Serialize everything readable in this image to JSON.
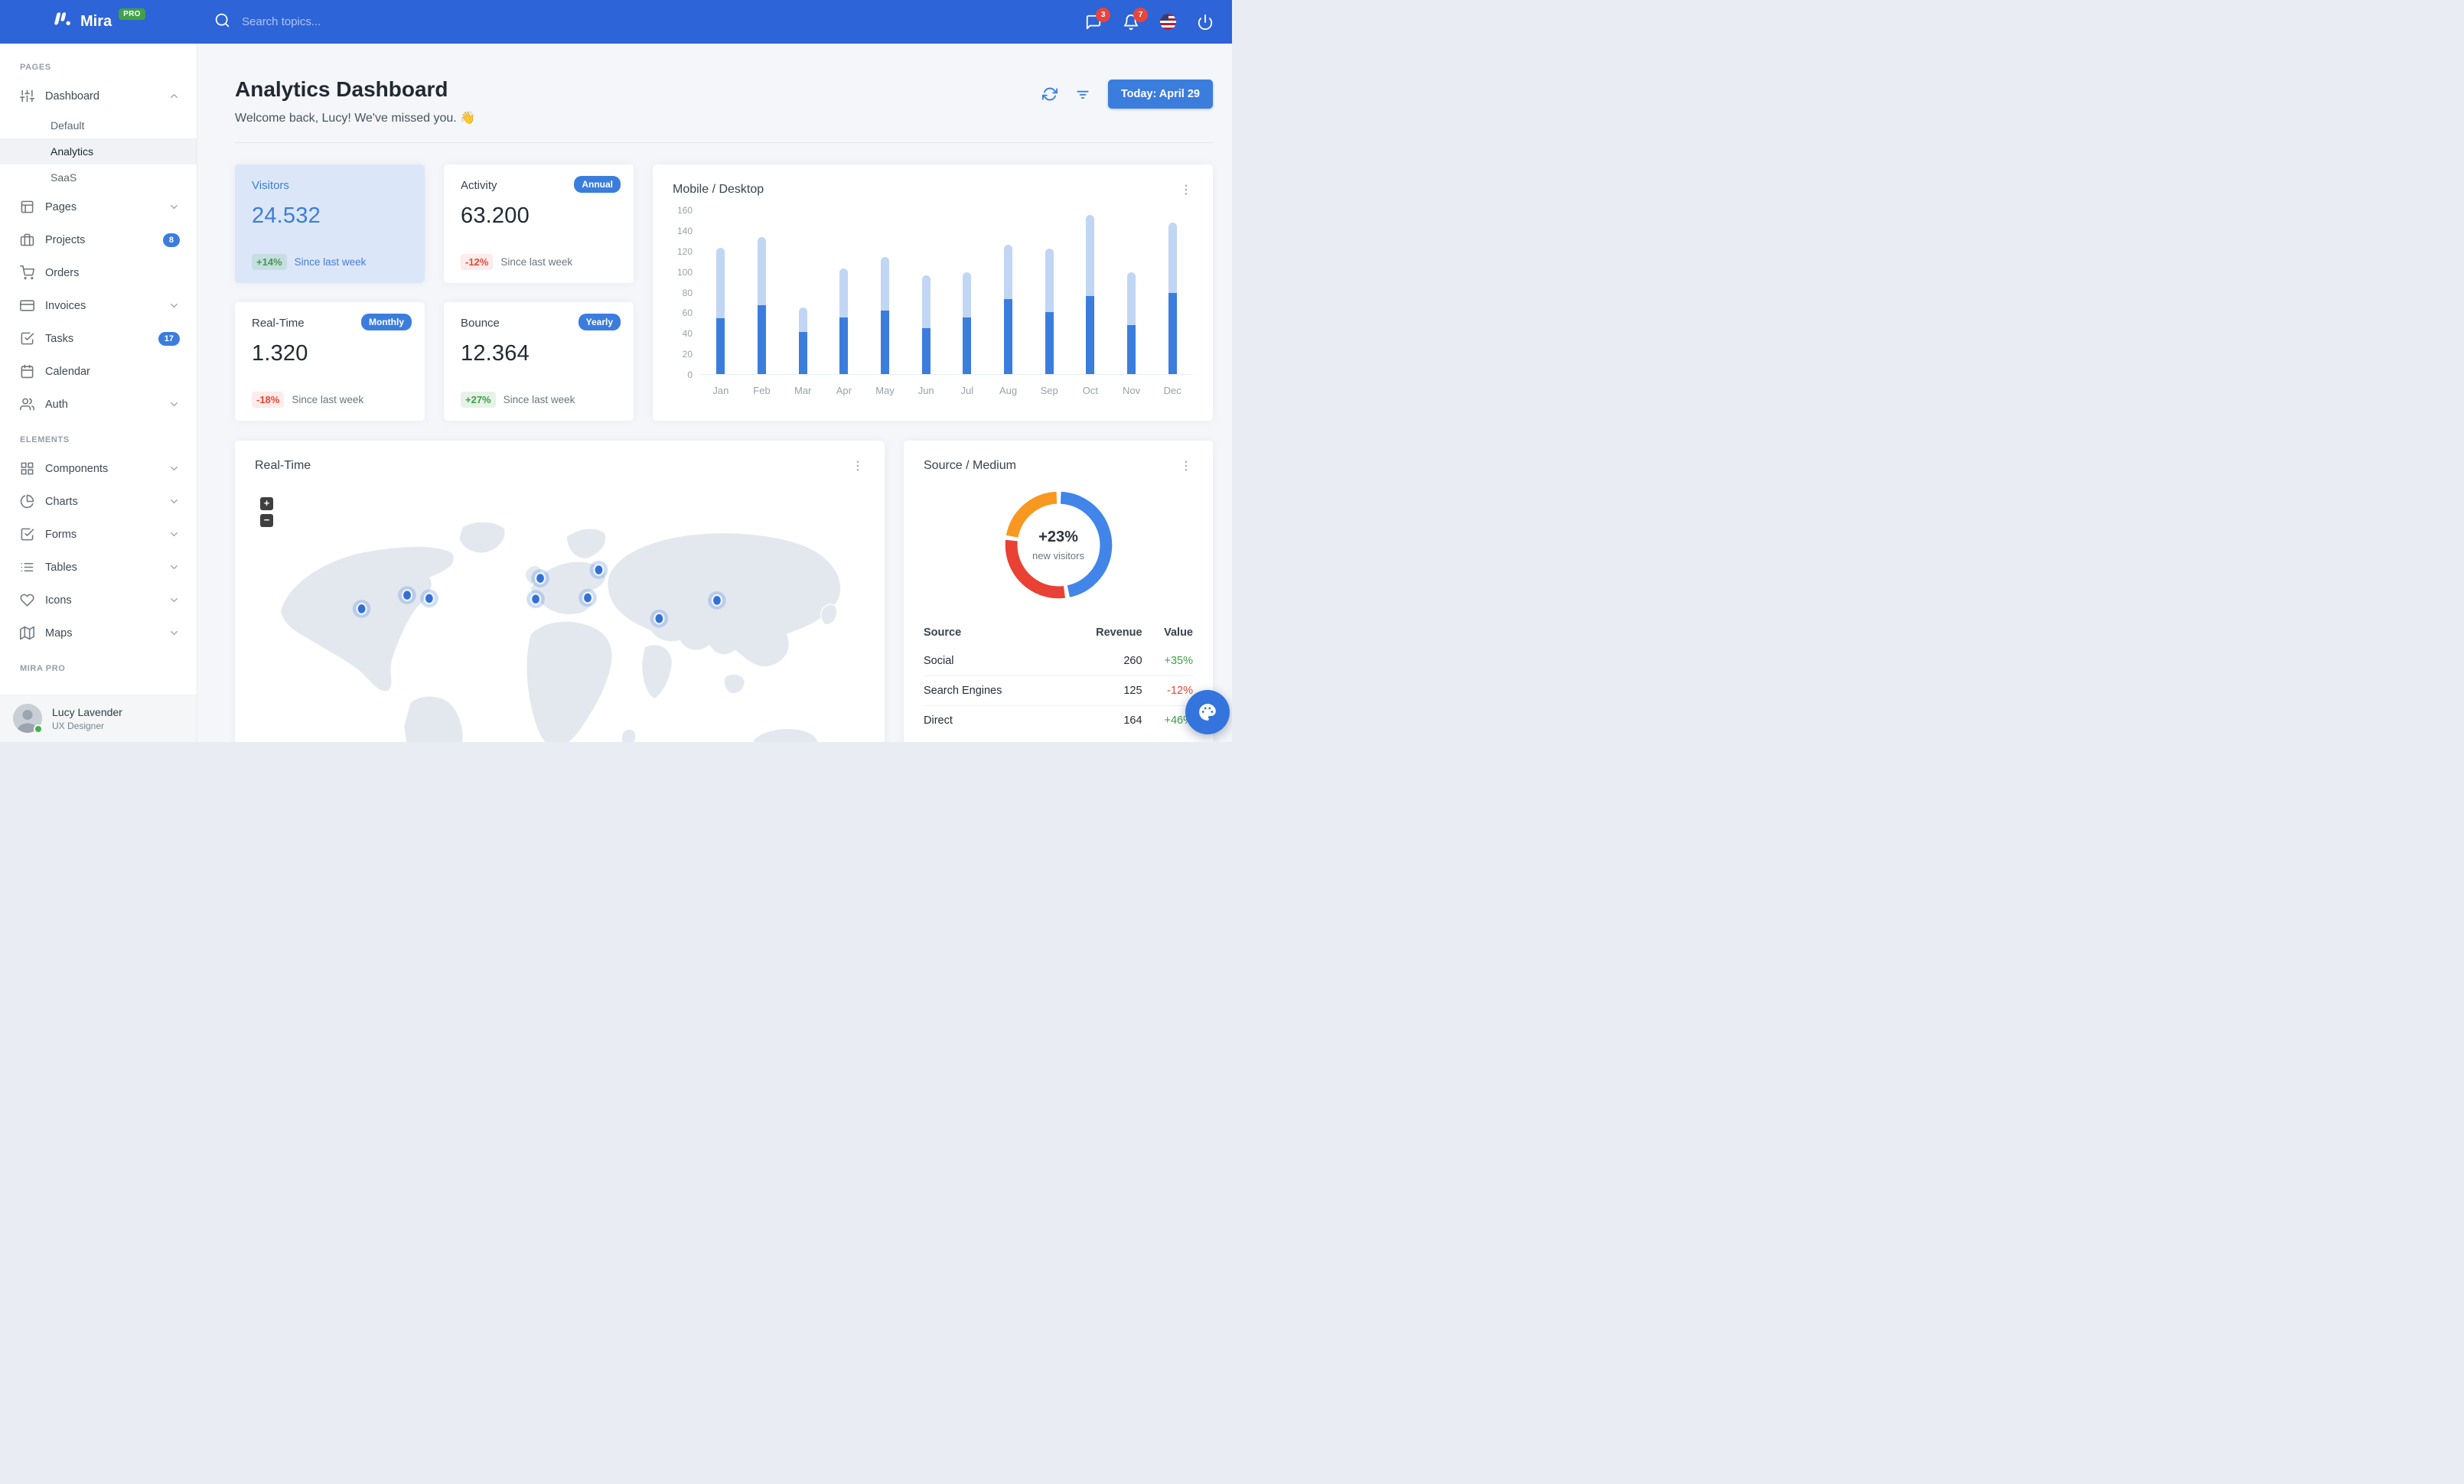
{
  "navbar": {
    "brand": "Mira",
    "brand_badge": "PRO",
    "search_placeholder": "Search topics...",
    "messages_badge": "3",
    "notifications_badge": "7"
  },
  "sidebar": {
    "sections": [
      {
        "label": "PAGES",
        "items": [
          {
            "label": "Dashboard",
            "icon": "sliders-icon",
            "expanded": true,
            "children": [
              {
                "label": "Default",
                "active": false
              },
              {
                "label": "Analytics",
                "active": true
              },
              {
                "label": "SaaS",
                "active": false
              }
            ]
          },
          {
            "label": "Pages",
            "icon": "layout-icon",
            "chevron": "down"
          },
          {
            "label": "Projects",
            "icon": "briefcase-icon",
            "badge": "8"
          },
          {
            "label": "Orders",
            "icon": "cart-icon"
          },
          {
            "label": "Invoices",
            "icon": "credit-card-icon",
            "chevron": "down"
          },
          {
            "label": "Tasks",
            "icon": "check-square-icon",
            "badge": "17"
          },
          {
            "label": "Calendar",
            "icon": "calendar-icon"
          },
          {
            "label": "Auth",
            "icon": "users-icon",
            "chevron": "down"
          }
        ]
      },
      {
        "label": "ELEMENTS",
        "items": [
          {
            "label": "Components",
            "icon": "grid-icon",
            "chevron": "down"
          },
          {
            "label": "Charts",
            "icon": "pie-chart-icon",
            "chevron": "down"
          },
          {
            "label": "Forms",
            "icon": "check-square-icon",
            "chevron": "down"
          },
          {
            "label": "Tables",
            "icon": "list-icon",
            "chevron": "down"
          },
          {
            "label": "Icons",
            "icon": "heart-icon",
            "chevron": "down"
          },
          {
            "label": "Maps",
            "icon": "map-icon",
            "chevron": "down"
          }
        ]
      },
      {
        "label": "MIRA PRO",
        "items": []
      }
    ],
    "user": {
      "name": "Lucy Lavender",
      "role": "UX Designer",
      "status": "online"
    }
  },
  "header": {
    "title": "Analytics Dashboard",
    "welcome": "Welcome back, Lucy! We've missed you. 👋",
    "date_button": "Today: April 29"
  },
  "stats": [
    {
      "title": "Visitors",
      "value": "24.532",
      "delta": "+14%",
      "delta_dir": "up",
      "caption": "Since last week",
      "variant": "primary"
    },
    {
      "title": "Activity",
      "value": "63.200",
      "badge": "Annual",
      "delta": "-12%",
      "delta_dir": "down",
      "caption": "Since last week"
    },
    {
      "title": "Real-Time",
      "value": "1.320",
      "badge": "Monthly",
      "delta": "-18%",
      "delta_dir": "down",
      "caption": "Since last week"
    },
    {
      "title": "Bounce",
      "value": "12.364",
      "badge": "Yearly",
      "delta": "+27%",
      "delta_dir": "up",
      "caption": "Since last week"
    }
  ],
  "chart_data": [
    {
      "type": "bar",
      "title": "Mobile / Desktop",
      "stacked": true,
      "categories": [
        "Jan",
        "Feb",
        "Mar",
        "Apr",
        "May",
        "Jun",
        "Jul",
        "Aug",
        "Sep",
        "Oct",
        "Nov",
        "Dec"
      ],
      "series": [
        {
          "name": "Mobile",
          "color": "#3b7ddd",
          "values": [
            54,
            67,
            41,
            55,
            62,
            45,
            55,
            73,
            60,
            76,
            48,
            79
          ]
        },
        {
          "name": "Desktop",
          "color": "#c1d6f4",
          "values": [
            69,
            66,
            24,
            48,
            52,
            51,
            44,
            53,
            62,
            79,
            51,
            68
          ]
        }
      ],
      "xlabel": "",
      "ylabel": "",
      "ylim": [
        0,
        160
      ],
      "ytick_step": 20,
      "grid": false,
      "legend": "none"
    },
    {
      "type": "donut",
      "title": "Source / Medium",
      "center_value": "+23%",
      "center_label": "new visitors",
      "slices": [
        {
          "label": "Social",
          "value": 260,
          "color": "#4285e8"
        },
        {
          "label": "Direct",
          "value": 164,
          "color": "#e94134"
        },
        {
          "label": "Search Engines",
          "value": 125,
          "color": "#f89820"
        }
      ],
      "legend": "none"
    }
  ],
  "map_card": {
    "title": "Real-Time",
    "zoom_in": "+",
    "zoom_out": "−",
    "marker_color": "#3b7ddd",
    "markers": [
      [
        195,
        186
      ],
      [
        265,
        165
      ],
      [
        299,
        170
      ],
      [
        470,
        139
      ],
      [
        463,
        171
      ],
      [
        560,
        126
      ],
      [
        543,
        169
      ],
      [
        653,
        201
      ],
      [
        742,
        173
      ]
    ]
  },
  "source_table": {
    "headers": [
      "Source",
      "Revenue",
      "Value"
    ],
    "rows": [
      {
        "source": "Social",
        "revenue": "260",
        "value": "+35%",
        "dir": "up"
      },
      {
        "source": "Search Engines",
        "revenue": "125",
        "value": "-12%",
        "dir": "down"
      },
      {
        "source": "Direct",
        "revenue": "164",
        "value": "+46%",
        "dir": "up"
      }
    ]
  },
  "colors": {
    "navbar": "#2d64d8",
    "primary": "#3b7ddd",
    "success": "#3f9e44",
    "danger": "#ee4437",
    "badge_red": "#e8453c",
    "pro_green": "#43a047",
    "visitors_card_bg": "#dbe7f8",
    "page_bg": "#f4f6fa"
  }
}
